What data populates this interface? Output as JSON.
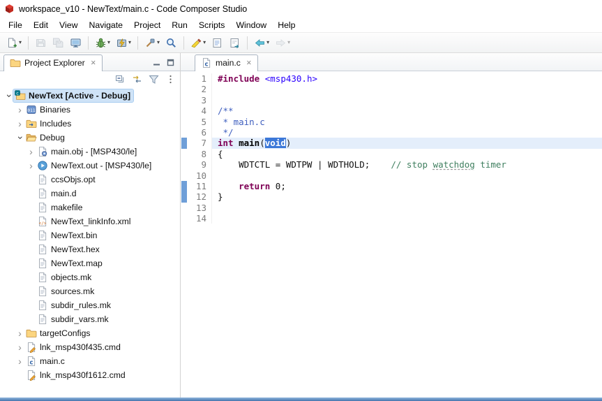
{
  "window": {
    "title": "workspace_v10 - NewText/main.c - Code Composer Studio"
  },
  "menu": {
    "items": [
      "File",
      "Edit",
      "View",
      "Navigate",
      "Project",
      "Run",
      "Scripts",
      "Window",
      "Help"
    ]
  },
  "toolbar": {
    "buttons": [
      {
        "name": "new-file",
        "dropdown": true
      },
      {
        "sep": true
      },
      {
        "name": "save",
        "disabled": true
      },
      {
        "name": "save-all",
        "disabled": true
      },
      {
        "name": "new-target-configuration"
      },
      {
        "sep": true
      },
      {
        "name": "debug",
        "dropdown": true
      },
      {
        "name": "flash",
        "dropdown": true
      },
      {
        "sep": true
      },
      {
        "name": "tools",
        "dropdown": true
      },
      {
        "name": "search"
      },
      {
        "sep": true
      },
      {
        "name": "highlight",
        "dropdown": true
      },
      {
        "name": "open-document"
      },
      {
        "name": "open-document-alt"
      },
      {
        "sep": true
      },
      {
        "name": "back",
        "dropdown": true
      },
      {
        "name": "forward",
        "dropdown": true,
        "disabled": true
      }
    ]
  },
  "explorer": {
    "tab_label": "Project Explorer",
    "toolbar": [
      {
        "name": "collapse-all"
      },
      {
        "name": "link-with-editor"
      },
      {
        "name": "filter"
      },
      {
        "name": "view-menu"
      }
    ],
    "panel_buttons": [
      {
        "name": "minimize"
      },
      {
        "name": "maximize"
      }
    ],
    "tree": [
      {
        "label": "NewText  [Active - Debug]",
        "level": 0,
        "exp": "open",
        "icon": "project",
        "selected": true,
        "bold": true
      },
      {
        "label": "Binaries",
        "level": 1,
        "exp": "closed",
        "icon": "binaries"
      },
      {
        "label": "Includes",
        "level": 1,
        "exp": "closed",
        "icon": "includes"
      },
      {
        "label": "Debug",
        "level": 1,
        "exp": "open",
        "icon": "folder-open"
      },
      {
        "label": "main.obj - [MSP430/le]",
        "level": 2,
        "exp": "closed",
        "icon": "obj-file"
      },
      {
        "label": "NewText.out - [MSP430/le]",
        "level": 2,
        "exp": "closed",
        "icon": "out-file"
      },
      {
        "label": "ccsObjs.opt",
        "level": 2,
        "exp": "none",
        "icon": "file"
      },
      {
        "label": "main.d",
        "level": 2,
        "exp": "none",
        "icon": "file"
      },
      {
        "label": "makefile",
        "level": 2,
        "exp": "none",
        "icon": "file"
      },
      {
        "label": "NewText_linkInfo.xml",
        "level": 2,
        "exp": "none",
        "icon": "xml-file"
      },
      {
        "label": "NewText.bin",
        "level": 2,
        "exp": "none",
        "icon": "file"
      },
      {
        "label": "NewText.hex",
        "level": 2,
        "exp": "none",
        "icon": "file"
      },
      {
        "label": "NewText.map",
        "level": 2,
        "exp": "none",
        "icon": "file"
      },
      {
        "label": "objects.mk",
        "level": 2,
        "exp": "none",
        "icon": "file"
      },
      {
        "label": "sources.mk",
        "level": 2,
        "exp": "none",
        "icon": "file"
      },
      {
        "label": "subdir_rules.mk",
        "level": 2,
        "exp": "none",
        "icon": "file"
      },
      {
        "label": "subdir_vars.mk",
        "level": 2,
        "exp": "none",
        "icon": "file"
      },
      {
        "label": "targetConfigs",
        "level": 1,
        "exp": "closed",
        "icon": "folder"
      },
      {
        "label": "lnk_msp430f435.cmd",
        "level": 1,
        "exp": "closed",
        "icon": "cmd-file"
      },
      {
        "label": "main.c",
        "level": 1,
        "exp": "closed",
        "icon": "c-file"
      },
      {
        "label": "lnk_msp430f1612.cmd",
        "level": 1,
        "exp": "none",
        "icon": "cmd-file"
      }
    ]
  },
  "editor": {
    "tab_label": "main.c",
    "lines": [
      {
        "n": 1,
        "tokens": [
          {
            "t": "pp",
            "s": "#include"
          },
          {
            "t": "plain",
            "s": " "
          },
          {
            "t": "str",
            "s": "<msp430.h>"
          }
        ]
      },
      {
        "n": 2,
        "tokens": []
      },
      {
        "n": 3,
        "tokens": []
      },
      {
        "n": 4,
        "tokens": [
          {
            "t": "doc",
            "s": "/**"
          }
        ]
      },
      {
        "n": 5,
        "tokens": [
          {
            "t": "doc",
            "s": " * main.c"
          }
        ]
      },
      {
        "n": 6,
        "tokens": [
          {
            "t": "doc",
            "s": " */"
          }
        ]
      },
      {
        "n": 7,
        "current": true,
        "tokens": [
          {
            "t": "kw",
            "s": "int"
          },
          {
            "t": "plain",
            "s": " "
          },
          {
            "t": "fn",
            "s": "main"
          },
          {
            "t": "plain",
            "s": "("
          },
          {
            "t": "sel",
            "s": "void"
          },
          {
            "t": "plain",
            "s": ")"
          }
        ]
      },
      {
        "n": 8,
        "tokens": [
          {
            "t": "plain",
            "s": "{"
          }
        ]
      },
      {
        "n": 9,
        "tokens": [
          {
            "t": "plain",
            "s": "    WDTCTL = WDTPW | WDTHOLD;"
          },
          {
            "t": "plain",
            "s": "    "
          },
          {
            "t": "cmt",
            "s": "// stop "
          },
          {
            "t": "cmtspell",
            "s": "watchdog"
          },
          {
            "t": "cmt",
            "s": " timer"
          }
        ]
      },
      {
        "n": 10,
        "tokens": []
      },
      {
        "n": 11,
        "tokens": [
          {
            "t": "plain",
            "s": "    "
          },
          {
            "t": "kw",
            "s": "return"
          },
          {
            "t": "plain",
            "s": " 0;"
          }
        ]
      },
      {
        "n": 12,
        "tokens": [
          {
            "t": "plain",
            "s": "}"
          }
        ]
      },
      {
        "n": 13,
        "tokens": []
      },
      {
        "n": 14,
        "tokens": []
      }
    ],
    "markers": [
      {
        "line": 7,
        "rows": 1
      },
      {
        "line": 11,
        "rows": 2
      }
    ]
  },
  "glyphs": {
    "close": "✕",
    "caret": "▾",
    "chevron": "›"
  },
  "colors": {
    "keyword": "#7f0055",
    "doc_comment": "#3f5fbf",
    "line_comment": "#3f7f5f",
    "string": "#2a00ff",
    "selection": "#3c78d8",
    "current_line": "#e4eefb",
    "marker": "#6f9fd8",
    "selected_row": "#cfe3f7",
    "bottom_bar": "#4474ad"
  }
}
